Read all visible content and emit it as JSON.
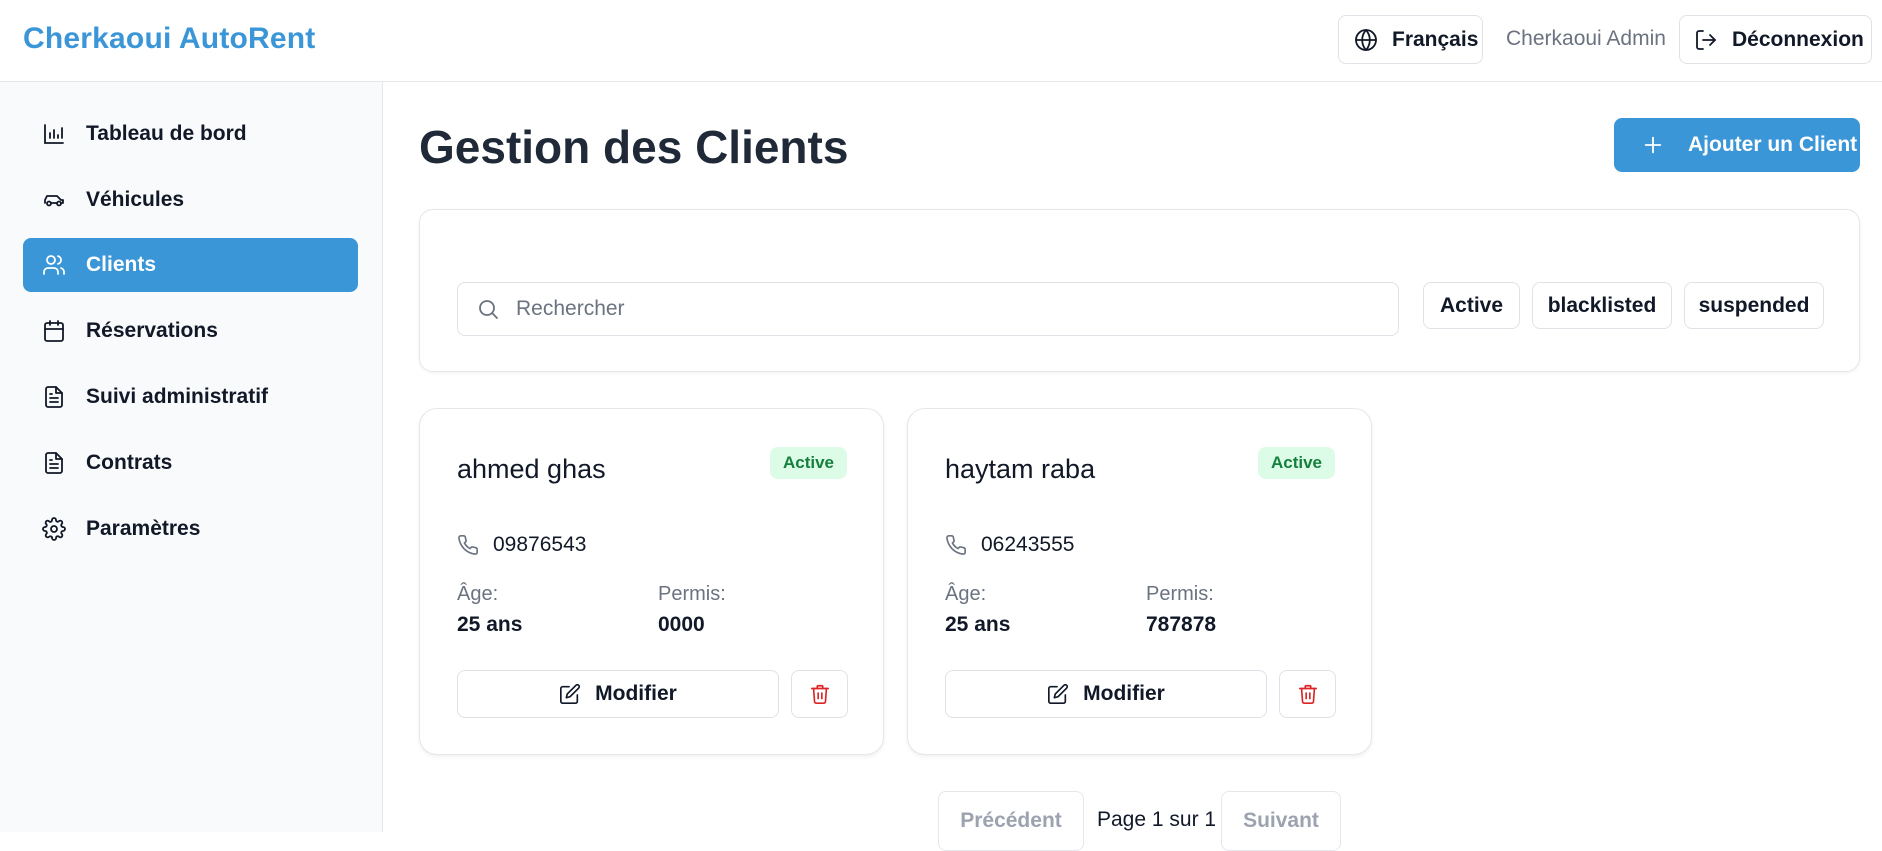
{
  "header": {
    "brand": "Cherkaoui AutoRent",
    "language_label": "Français",
    "user_name": "Cherkaoui Admin",
    "logout_label": "Déconnexion"
  },
  "sidebar": {
    "items": [
      {
        "label": "Tableau de bord",
        "icon": "bar-chart-icon",
        "active": false
      },
      {
        "label": "Véhicules",
        "icon": "car-icon",
        "active": false
      },
      {
        "label": "Clients",
        "icon": "users-icon",
        "active": true
      },
      {
        "label": "Réservations",
        "icon": "calendar-icon",
        "active": false
      },
      {
        "label": "Suivi administratif",
        "icon": "document-icon",
        "active": false
      },
      {
        "label": "Contrats",
        "icon": "document-icon",
        "active": false
      },
      {
        "label": "Paramètres",
        "icon": "gear-icon",
        "active": false
      }
    ]
  },
  "main": {
    "title": "Gestion des Clients",
    "add_button_label": "Ajouter un Client"
  },
  "filters": {
    "search_placeholder": "Rechercher",
    "search_value": "",
    "status_chips": [
      "Active",
      "blacklisted",
      "suspended"
    ]
  },
  "clients": [
    {
      "name": "ahmed ghas",
      "status": "Active",
      "phone": "09876543",
      "age_label": "Âge:",
      "age_value": "25 ans",
      "license_label": "Permis:",
      "license_value": "0000",
      "edit_label": "Modifier"
    },
    {
      "name": "haytam raba",
      "status": "Active",
      "phone": "06243555",
      "age_label": "Âge:",
      "age_value": "25 ans",
      "license_label": "Permis:",
      "license_value": "787878",
      "edit_label": "Modifier"
    }
  ],
  "pagination": {
    "prev_label": "Précédent",
    "page_text": "Page 1 sur 1",
    "next_label": "Suivant"
  },
  "colors": {
    "accent": "#3b96d8",
    "status_active_bg": "#dcfce7",
    "status_active_text": "#15803d",
    "delete": "#dc2626"
  }
}
